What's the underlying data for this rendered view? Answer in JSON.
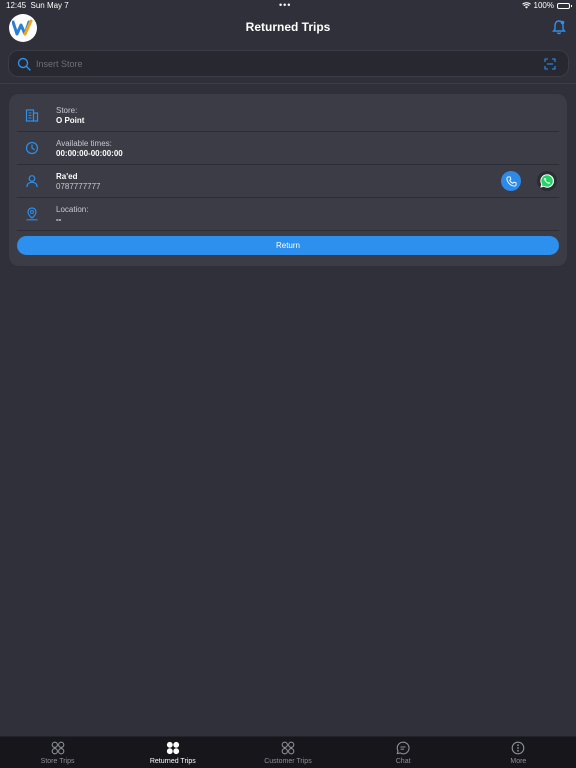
{
  "status_bar": {
    "time": "12:45",
    "date": "Sun May 7",
    "dots": "•••",
    "battery": "100%"
  },
  "header": {
    "title": "Returned Trips",
    "logo_icon": "app-logo-w",
    "notification_icon": "bell-icon"
  },
  "search": {
    "placeholder": "Insert Store",
    "value": ""
  },
  "card": {
    "store": {
      "label": "Store:",
      "value": "O Point",
      "icon": "building-icon"
    },
    "times": {
      "label": "Available times:",
      "value": "00:00:00-00:00:00",
      "icon": "clock-icon"
    },
    "contact": {
      "name": "Ra'ed",
      "phone": "0787777777",
      "icon": "user-icon"
    },
    "location": {
      "label": "Location:",
      "value": "--",
      "icon": "location-pin-icon"
    },
    "return_label": "Return"
  },
  "tabs": [
    {
      "label": "Store Trips",
      "icon": "grid-circles-icon",
      "active": false
    },
    {
      "label": "Returned Trips",
      "icon": "grid-circles-filled-icon",
      "active": true
    },
    {
      "label": "Customer Trips",
      "icon": "grid-circles-icon",
      "active": false
    },
    {
      "label": "Chat",
      "icon": "chat-bubble-icon",
      "active": false
    },
    {
      "label": "More",
      "icon": "more-dots-icon",
      "active": false
    }
  ],
  "colors": {
    "background": "#2f3039",
    "card": "#3b3c45",
    "accent": "#2d8fee",
    "tabbar": "#16161b",
    "whatsapp": "#25d366"
  }
}
